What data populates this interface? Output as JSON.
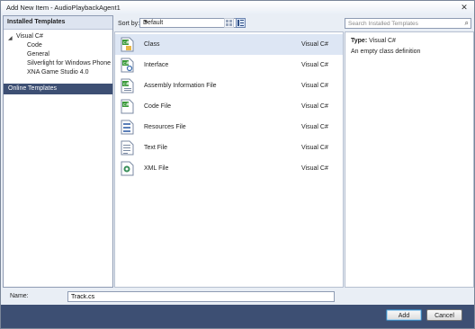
{
  "window": {
    "title": "Add New Item - AudioPlaybackAgent1"
  },
  "left_panel": {
    "header": "Installed Templates",
    "tree": [
      {
        "label": "Visual C#",
        "level": 0,
        "expanded": true
      },
      {
        "label": "Code",
        "level": 1
      },
      {
        "label": "General",
        "level": 1
      },
      {
        "label": "Silverlight for Windows Phone",
        "level": 1
      },
      {
        "label": "XNA Game Studio 4.0",
        "level": 1
      }
    ],
    "online": "Online Templates"
  },
  "toolbar": {
    "sort_label": "Sort by:",
    "sort_value": "Default",
    "search_placeholder": "Search Installed Templates"
  },
  "templates": [
    {
      "name": "Class",
      "type": "Visual C#",
      "selected": true,
      "icon": "class-file-icon"
    },
    {
      "name": "Interface",
      "type": "Visual C#",
      "icon": "interface-file-icon"
    },
    {
      "name": "Assembly Information File",
      "type": "Visual C#",
      "icon": "assembly-info-icon"
    },
    {
      "name": "Code File",
      "type": "Visual C#",
      "icon": "code-file-icon"
    },
    {
      "name": "Resources File",
      "type": "Visual C#",
      "icon": "resources-file-icon"
    },
    {
      "name": "Text File",
      "type": "Visual C#",
      "icon": "text-file-icon"
    },
    {
      "name": "XML File",
      "type": "Visual C#",
      "icon": "xml-file-icon"
    }
  ],
  "details": {
    "type_label": "Type:",
    "type_value": "Visual C#",
    "description": "An empty class definition"
  },
  "name_field": {
    "label": "Name:",
    "value": "Track.cs"
  },
  "buttons": {
    "add": "Add",
    "cancel": "Cancel"
  },
  "colors": {
    "accent_dark": "#3d4f73",
    "selection": "#dde6f4",
    "header_bg": "#dde4f0"
  }
}
